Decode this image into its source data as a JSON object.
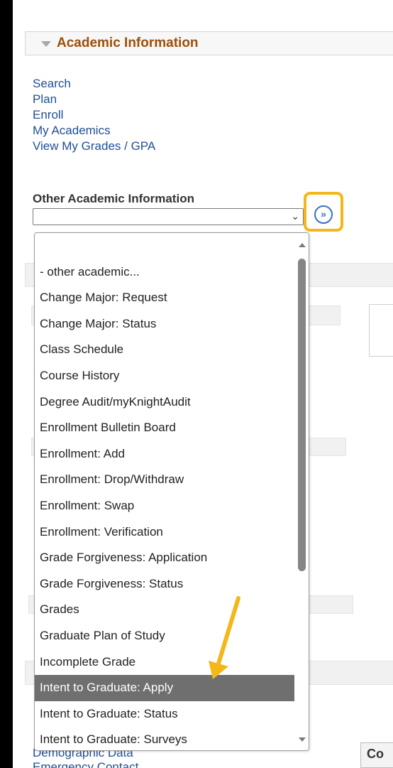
{
  "section": {
    "title": "Academic Information"
  },
  "links": [
    {
      "label": "Search"
    },
    {
      "label": "Plan"
    },
    {
      "label": "Enroll"
    },
    {
      "label": "My Academics"
    },
    {
      "label": "View My Grades / GPA"
    }
  ],
  "other_info": {
    "label": "Other Academic Information",
    "selected_value": "",
    "go_button_icon": "double-chevron-right-icon"
  },
  "dropdown": {
    "options": [
      "",
      "- other academic...",
      "Change Major: Request",
      "Change Major: Status",
      "Class Schedule",
      "Course History",
      "Degree Audit/myKnightAudit",
      "Enrollment Bulletin Board",
      "Enrollment: Add",
      "Enrollment: Drop/Withdraw",
      "Enrollment: Swap",
      "Enrollment: Verification",
      "Grade Forgiveness: Application",
      "Grade Forgiveness: Status",
      "Grades",
      "Graduate Plan of Study",
      "Incomplete Grade",
      "Intent to Graduate: Apply",
      "Intent to Graduate: Status",
      "Intent to Graduate: Surveys"
    ],
    "highlighted_option": "Intent to Graduate: Apply"
  },
  "bottom": {
    "partial_link": "Demographic Data",
    "partial_link2": "Emergency Contact",
    "partial_box": "Co"
  },
  "colors": {
    "annotation": "#f4b71b",
    "section_title": "#9c4f0b",
    "link": "#1f4e96",
    "highlight_bg": "#6f6f6f"
  }
}
